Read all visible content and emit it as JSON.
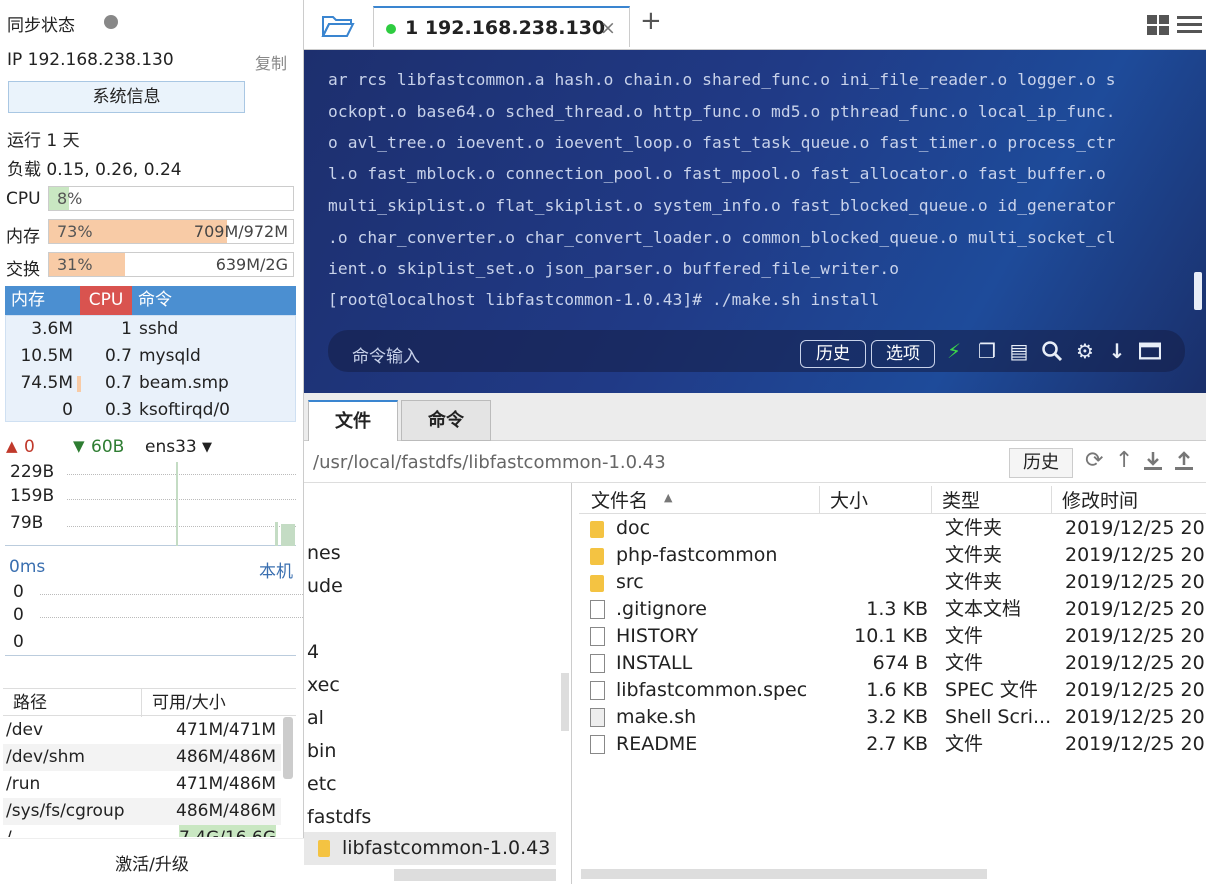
{
  "sidebar": {
    "sync_label": "同步状态",
    "ip": "IP 192.168.238.130",
    "copy": "复制",
    "sysinfo": "系统信息",
    "uptime": "运行 1 天",
    "load": "负载 0.15, 0.26, 0.24",
    "cpu_label": "CPU",
    "cpu_pct": "8%",
    "cpu_fraction": 0.08,
    "mem_label": "内存",
    "mem_pct": "73%",
    "mem_used": "709M/972M",
    "mem_fraction": 0.73,
    "swap_label": "交换",
    "swap_pct": "31%",
    "swap_used": "639M/2G",
    "swap_fraction": 0.31,
    "proc_headers": [
      "内存",
      "CPU",
      "命令"
    ],
    "processes": [
      {
        "mem": "3.6M",
        "cpu": "1",
        "cmd": "sshd"
      },
      {
        "mem": "10.5M",
        "cpu": "0.7",
        "cmd": "mysqld"
      },
      {
        "mem": "74.5M",
        "cpu": "0.7",
        "cmd": "beam.smp"
      },
      {
        "mem": "0",
        "cpu": "0.3",
        "cmd": "ksoftirqd/0"
      }
    ],
    "net_up": "0",
    "net_down": "60B",
    "iface": "ens33",
    "net_scale": [
      "229B",
      "159B",
      "79B"
    ],
    "latency": "0ms",
    "host": "本机",
    "lat_vals": [
      "0",
      "0",
      "0"
    ],
    "disk_headers": [
      "路径",
      "可用/大小"
    ],
    "disks": [
      {
        "path": "/dev",
        "size": "471M/471M"
      },
      {
        "path": "/dev/shm",
        "size": "486M/486M"
      },
      {
        "path": "/run",
        "size": "471M/486M"
      },
      {
        "path": "/sys/fs/cgroup",
        "size": "486M/486M"
      },
      {
        "path": "/",
        "size": "7.4G/16.6G"
      }
    ],
    "activate": "激活/升级"
  },
  "tabs": {
    "session": "1 192.168.238.130",
    "add": "+"
  },
  "terminal": {
    "lines": [
      "ar rcs libfastcommon.a hash.o chain.o shared_func.o ini_file_reader.o logger.o s",
      "ockopt.o base64.o sched_thread.o http_func.o md5.o pthread_func.o local_ip_func.",
      "o avl_tree.o ioevent.o ioevent_loop.o fast_task_queue.o fast_timer.o process_ctr",
      "l.o fast_mblock.o connection_pool.o fast_mpool.o fast_allocator.o fast_buffer.o",
      "multi_skiplist.o flat_skiplist.o system_info.o fast_blocked_queue.o id_generator",
      ".o char_converter.o char_convert_loader.o common_blocked_queue.o multi_socket_cl",
      "ient.o skiplist_set.o json_parser.o buffered_file_writer.o",
      "[root@localhost libfastcommon-1.0.43]# ./make.sh install"
    ],
    "cmd_placeholder": "命令输入",
    "history": "历史",
    "options": "选项"
  },
  "fm": {
    "tab_files": "文件",
    "tab_cmd": "命令",
    "path": "/usr/local/fastdfs/libfastcommon-1.0.43",
    "history": "历史",
    "tree": [
      "nes",
      "ude",
      "4",
      "xec",
      "al",
      "bin",
      "etc",
      "fastdfs",
      "libfastcommon-1.0.43"
    ],
    "headers": [
      "文件名",
      "大小",
      "类型",
      "修改时间"
    ],
    "files": [
      {
        "name": "doc",
        "size": "",
        "type": "文件夹",
        "date": "2019/12/25 20",
        "icon": "folder"
      },
      {
        "name": "php-fastcommon",
        "size": "",
        "type": "文件夹",
        "date": "2019/12/25 20",
        "icon": "folder"
      },
      {
        "name": "src",
        "size": "",
        "type": "文件夹",
        "date": "2019/12/25 20",
        "icon": "folder"
      },
      {
        "name": ".gitignore",
        "size": "1.3 KB",
        "type": "文本文档",
        "date": "2019/12/25 20",
        "icon": "doc"
      },
      {
        "name": "HISTORY",
        "size": "10.1 KB",
        "type": "文件",
        "date": "2019/12/25 20",
        "icon": "doc"
      },
      {
        "name": "INSTALL",
        "size": "674 B",
        "type": "文件",
        "date": "2019/12/25 20",
        "icon": "doc"
      },
      {
        "name": "libfastcommon.spec",
        "size": "1.6 KB",
        "type": "SPEC 文件",
        "date": "2019/12/25 20",
        "icon": "doc"
      },
      {
        "name": "make.sh",
        "size": "3.2 KB",
        "type": "Shell Scri...",
        "date": "2019/12/25 20",
        "icon": "script"
      },
      {
        "name": "README",
        "size": "2.7 KB",
        "type": "文件",
        "date": "2019/12/25 20",
        "icon": "doc"
      }
    ]
  }
}
